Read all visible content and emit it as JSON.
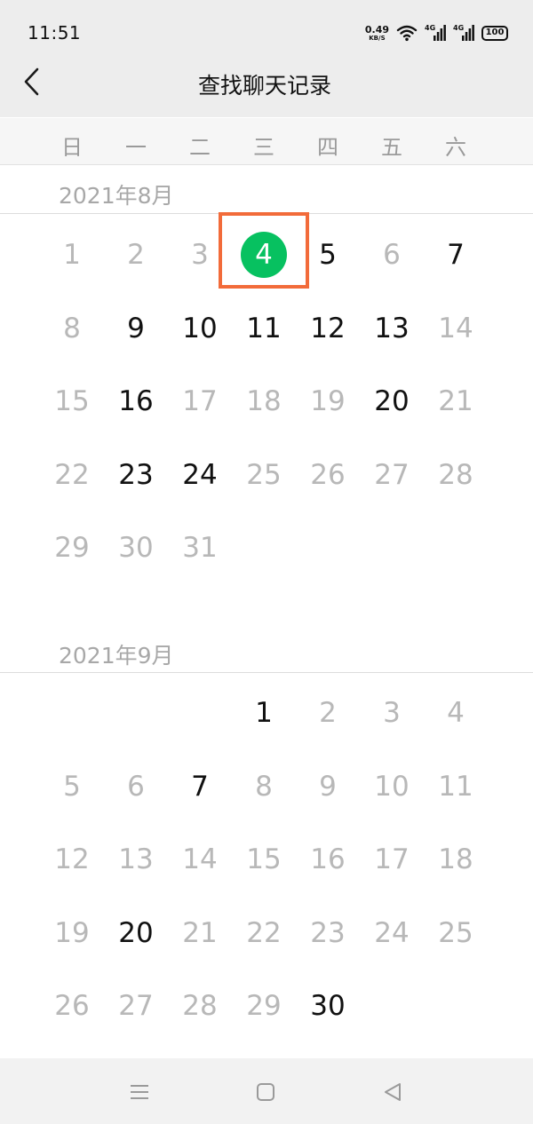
{
  "status_bar": {
    "time": "11:51",
    "net_speed_value": "0.49",
    "net_speed_unit": "KB/S",
    "sim1_label": "4G",
    "sim2_label": "4G",
    "battery": "100"
  },
  "header": {
    "title": "查找聊天记录",
    "back_icon": "chevron-left-icon"
  },
  "weekdays": [
    "日",
    "一",
    "二",
    "三",
    "四",
    "五",
    "六"
  ],
  "months": [
    {
      "title": "2021年8月",
      "first_weekday": 0,
      "days_in_month": 31,
      "days_with_records": [
        4,
        5,
        7,
        9,
        10,
        11,
        12,
        13,
        16,
        20,
        23,
        24
      ],
      "selected_day": 4
    },
    {
      "title": "2021年9月",
      "first_weekday": 3,
      "days_in_month": 30,
      "days_with_records": [
        1,
        7,
        20,
        30
      ],
      "selected_day": null
    }
  ],
  "colors": {
    "selected_circle": "#07c160",
    "highlight_box": "#f26b3a",
    "active_day_text": "#111111",
    "inactive_day_text": "#b8b8b8"
  },
  "nav_bar": {
    "menu_icon": "menu-icon",
    "home_icon": "home-square-icon",
    "back_icon": "back-triangle-icon"
  }
}
